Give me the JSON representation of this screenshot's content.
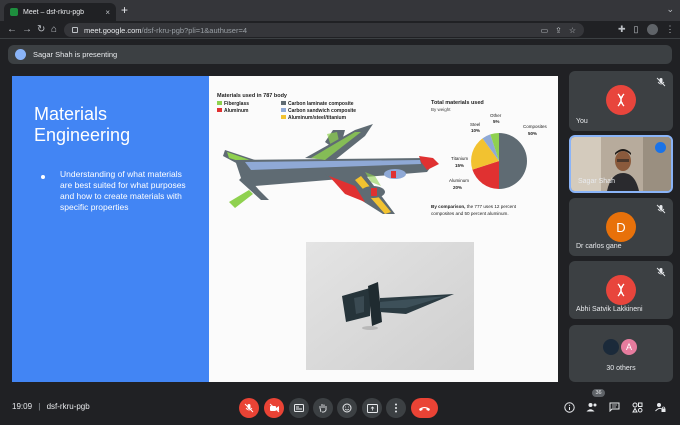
{
  "browser": {
    "tab_title": "Meet – dsf-rkru-pgb",
    "tab_close": "×",
    "new_tab": "+",
    "url_host": "meet.google.com",
    "url_path": "/dsf-rkru-pgb?pli=1&authuser=4"
  },
  "presenting": {
    "text": "Sagar Shah is presenting"
  },
  "slide": {
    "title_line1": "Materials",
    "title_line2": "Engineering",
    "bullet": "Understanding of what materials are best suited for what purposes and how to create materials with specific properties",
    "infographic": {
      "heading": "Materials used in 787 body",
      "legend": [
        {
          "label": "Fiberglass",
          "color": "#8fd14f"
        },
        {
          "label": "Aluminum",
          "color": "#e03131"
        },
        {
          "label": "Carbon laminate composite",
          "color": "#5f6b73"
        },
        {
          "label": "Carbon sandwich composite",
          "color": "#8fa9d6"
        },
        {
          "label": "Aluminum/steel/titanium",
          "color": "#f2c230"
        }
      ],
      "pie_title": "Total materials used",
      "pie_subtitle": "By weight",
      "pie_labels": {
        "other": "Other",
        "other_pct": "5%",
        "steel": "Steel",
        "steel_pct": "10%",
        "composites": "Composites",
        "composites_pct": "50%",
        "titanium": "Titanium",
        "titanium_pct": "15%",
        "aluminum": "Aluminum",
        "aluminum_pct": "20%"
      },
      "comparison_bold": "By comparison,",
      "comparison_rest_1": " the 777 uses 12 percent",
      "comparison_rest_2": "composites and 50 percent aluminum."
    }
  },
  "participants": [
    {
      "name": "You",
      "kind": "avatar",
      "color": "#e8453c"
    },
    {
      "name": "Sagar Shah",
      "kind": "video"
    },
    {
      "name": "Dr carlos gane",
      "kind": "initial",
      "initial": "D",
      "color": "#e8710a"
    },
    {
      "name": "Abhi Satvik Lakkineni",
      "kind": "avatar",
      "color": "#e8453c"
    },
    {
      "name": "30 others",
      "kind": "group",
      "initial": "A",
      "color": "#e67c9e"
    }
  ],
  "bottom": {
    "time": "19:09",
    "separator": "|",
    "meeting_code": "dsf-rkru-pgb",
    "people_count": "36"
  },
  "colors": {
    "red": "#ea4335",
    "tile": "#3c4043",
    "accent": "#8ab4f8",
    "slide_blue": "#4285f4"
  }
}
